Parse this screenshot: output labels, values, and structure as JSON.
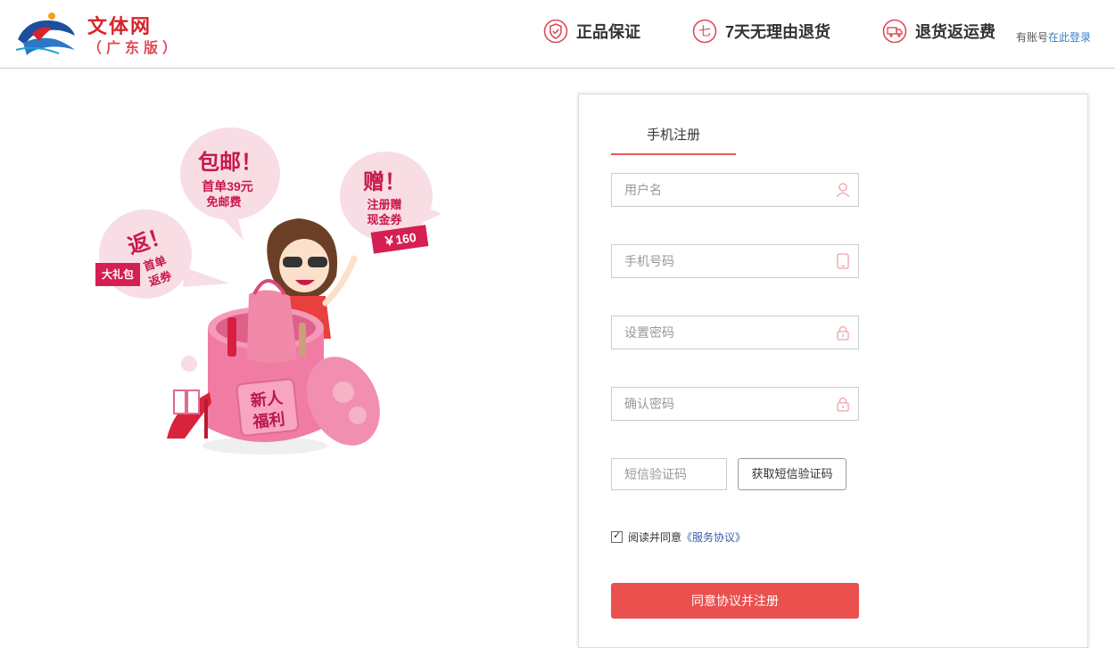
{
  "header": {
    "brand_name": "文体网",
    "brand_sub": "（广东版）",
    "features": [
      {
        "icon": "shield-check-icon",
        "label": "正品保证"
      },
      {
        "icon": "seven-circle-icon",
        "label": "7天无理由退货"
      },
      {
        "icon": "truck-icon",
        "label": "退货返运费"
      }
    ],
    "login_prefix": "有账号",
    "login_link": "在此登录"
  },
  "promo": {
    "bubble_mail_title": "包邮！",
    "bubble_mail_line1": "首单39元",
    "bubble_mail_line2": "免邮费",
    "bubble_gift_title": "赠！",
    "bubble_gift_line1": "注册赠",
    "bubble_gift_line2": "现金券",
    "bubble_gift_amount": "￥160",
    "bubble_return_title": "返！",
    "bubble_return_line1": "首单",
    "bubble_return_line2": "返券",
    "bubble_return_tag": "大礼包",
    "box_line1": "新人",
    "box_line2": "福利"
  },
  "form": {
    "tab_label": "手机注册",
    "username_placeholder": "用户名",
    "phone_placeholder": "手机号码",
    "password_placeholder": "设置密码",
    "confirm_placeholder": "确认密码",
    "sms_placeholder": "短信验证码",
    "sms_button": "获取短信验证码",
    "agree_text": "阅读并同意",
    "agree_link": "《服务协议》",
    "submit_label": "同意协议并注册"
  },
  "colors": {
    "accent": "#e9504e",
    "brand_red": "#d8232a",
    "link": "#3a7ec7"
  }
}
